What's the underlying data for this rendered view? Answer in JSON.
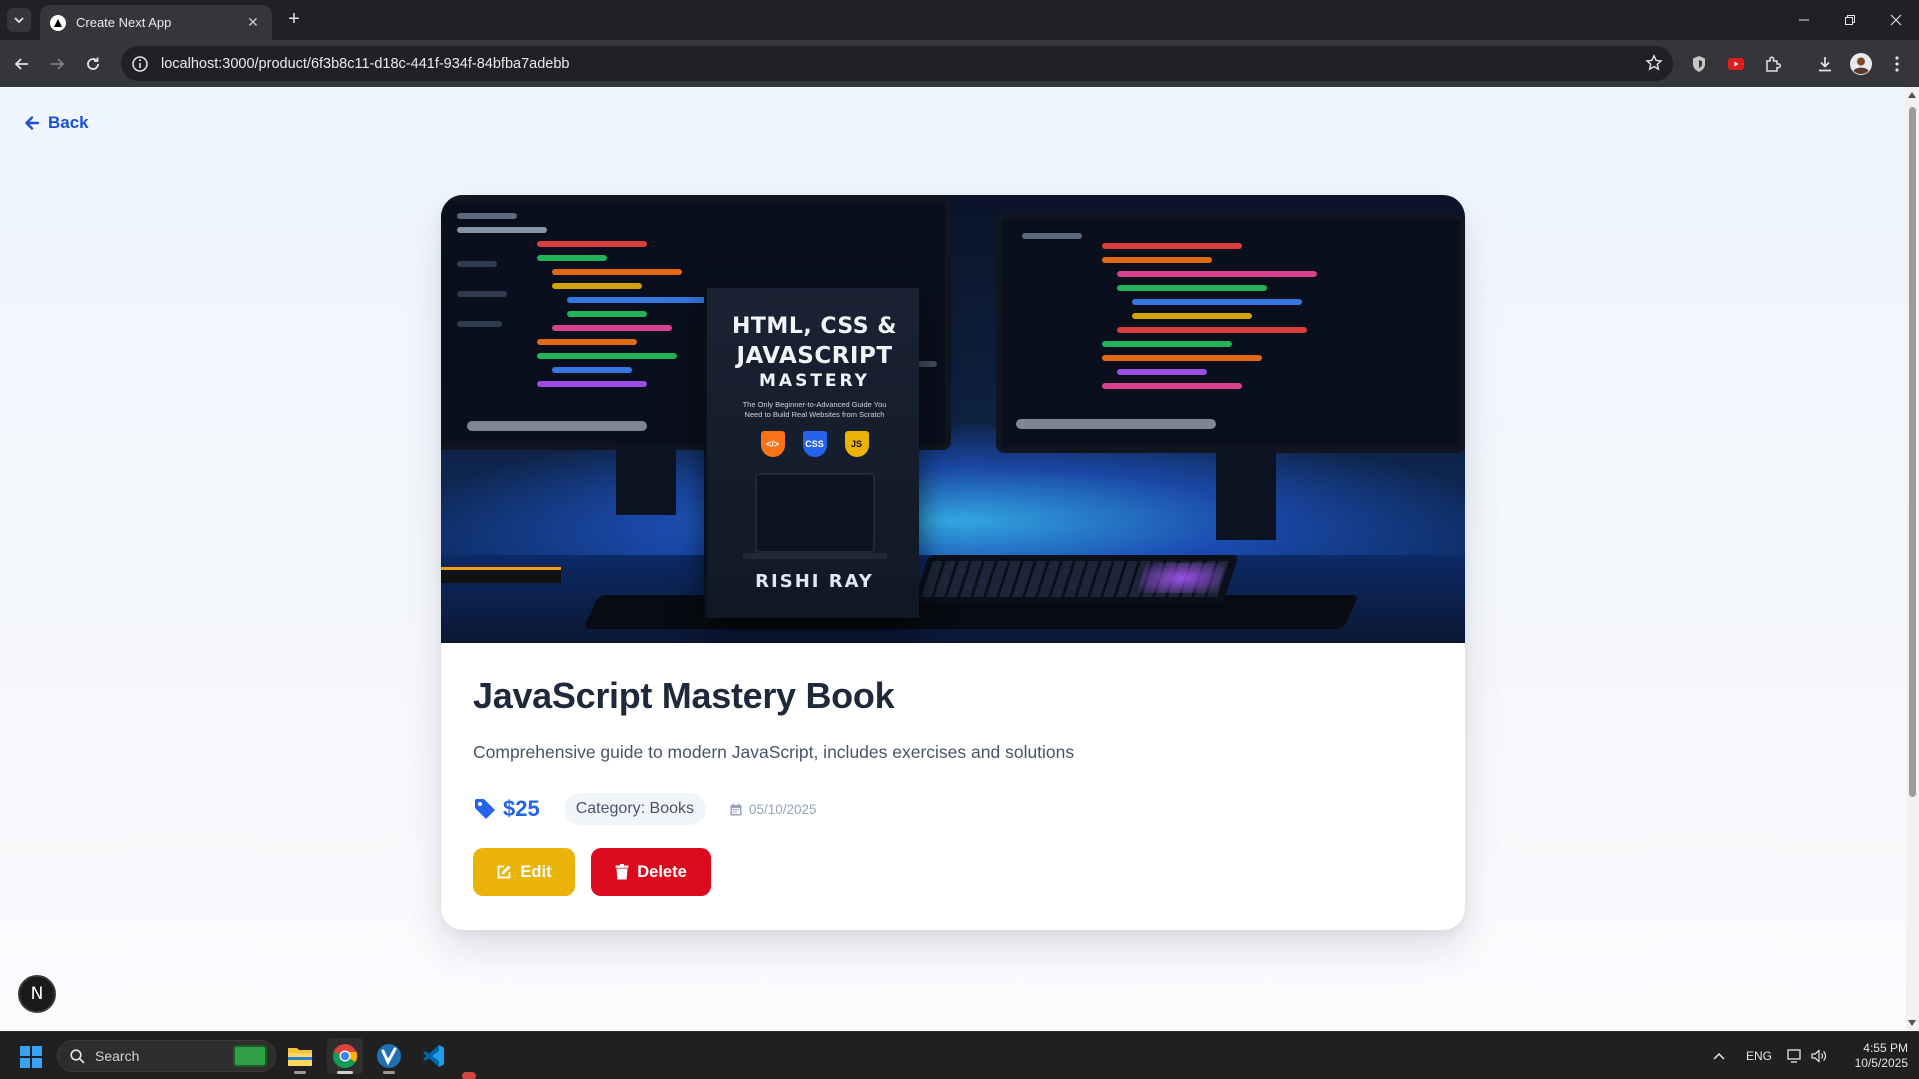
{
  "browser": {
    "tab_title": "Create Next App",
    "url_host": "localhost:",
    "url_rest": "3000/product/6f3b8c11-d18c-441f-934f-84bfba7adebb"
  },
  "page": {
    "back_label": "Back",
    "product": {
      "title": "JavaScript Mastery Book",
      "description": "Comprehensive guide to modern JavaScript, includes exercises and solutions",
      "price": "$25",
      "category": "Category: Books",
      "date": "05/10/2025"
    },
    "actions": {
      "edit_label": "Edit",
      "delete_label": "Delete"
    },
    "hero_image": {
      "title_line1": "HTML, CSS &",
      "title_line2": "JAVASCRIPT",
      "title_line3": "MASTERY",
      "subtitle": "The Only Beginner-to-Advanced Guide You Need to Build Real Websites from Scratch",
      "badge_html": "</>",
      "badge_css": "CSS",
      "badge_js": "JS",
      "author": "RISHI RAY"
    },
    "dev_badge": "N"
  },
  "taskbar": {
    "search_label": "Search",
    "language": "ENG",
    "time": "4:55 PM",
    "date": "10/5/2025"
  },
  "colors": {
    "accent_blue": "#2563eb",
    "edit_yellow": "#eab308",
    "delete_red": "#dc0a1e",
    "title_dark": "#1e293b"
  }
}
